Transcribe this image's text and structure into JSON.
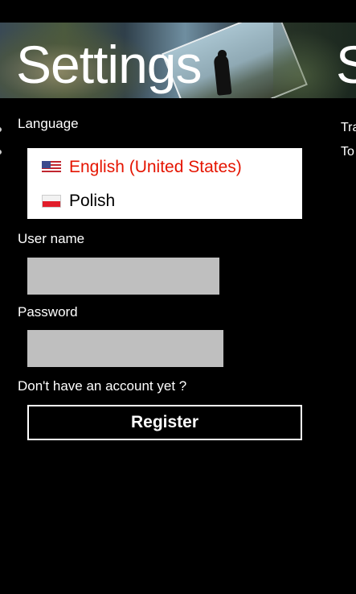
{
  "header": {
    "title": "Settings",
    "next_title": "S"
  },
  "language": {
    "label": "Language",
    "options": [
      {
        "label": "English (United States)",
        "flag": "us-flag-icon",
        "selected": true
      },
      {
        "label": "Polish",
        "flag": "pl-flag-icon",
        "selected": false
      }
    ]
  },
  "username": {
    "label": "User name",
    "value": ""
  },
  "password": {
    "label": "Password",
    "value": ""
  },
  "account": {
    "prompt": "Don't have an account yet ?",
    "register_label": "Register"
  },
  "next_panel": {
    "line1": "Tra",
    "line2": "To"
  },
  "colors": {
    "accent": "#e51400",
    "background": "#000000",
    "textbox": "#bfbfbf"
  }
}
